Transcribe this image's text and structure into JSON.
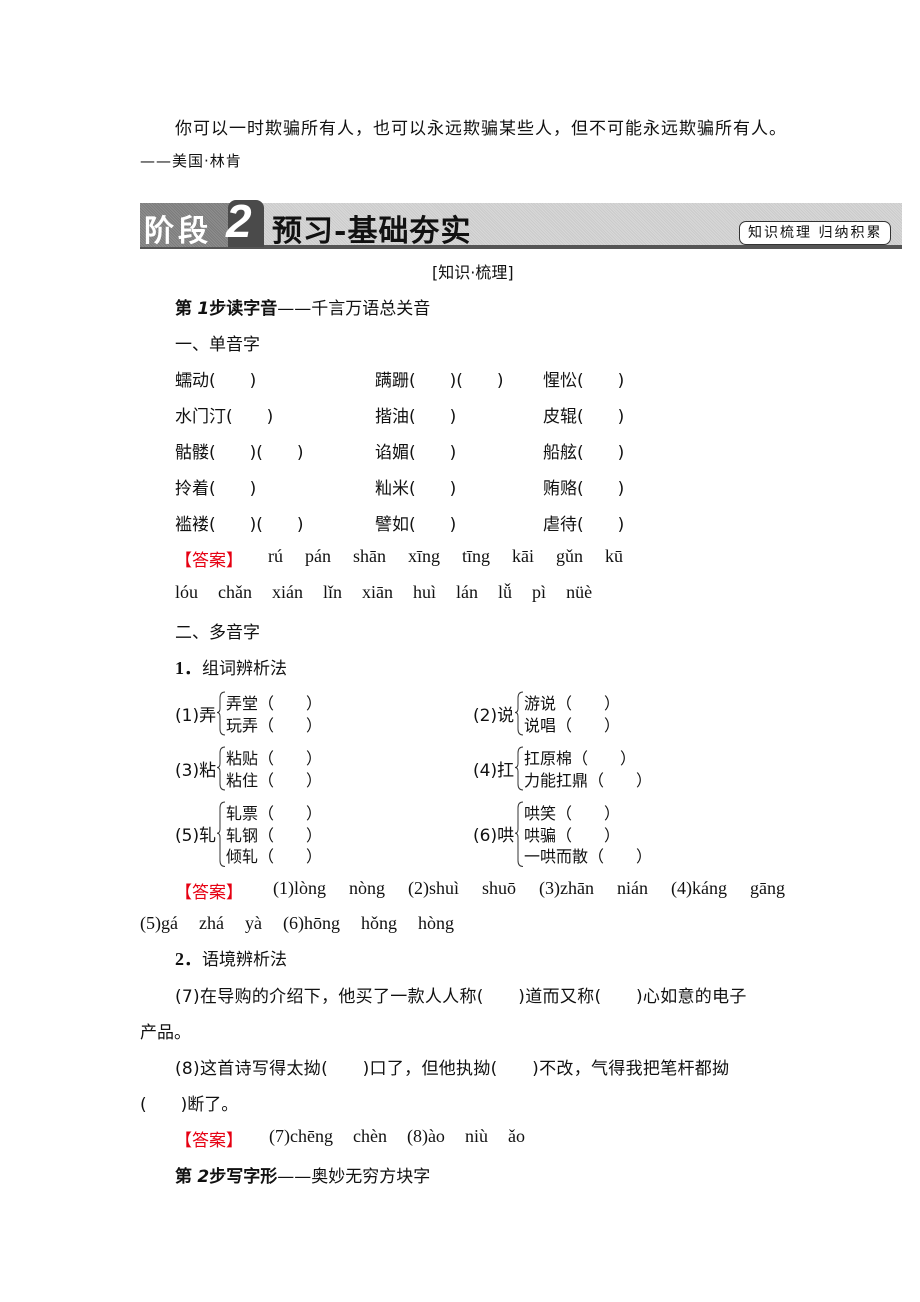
{
  "quote": {
    "text": "你可以一时欺骗所有人，也可以永远欺骗某些人，但不可能永远欺骗所有人。",
    "attribution": "——美国·林肯"
  },
  "banner": {
    "stage_label": "阶段",
    "stage_number": "2",
    "title": "预习-基础夯实",
    "tag": "知识梳理 归纳积累"
  },
  "section_label": "[知识·梳理]",
  "step1": {
    "prefix": "第",
    "number": "1",
    "title": "步读字音",
    "subtitle": "——千言万语总关音"
  },
  "part1": {
    "heading": "一、单音字",
    "rows": [
      [
        "蠕动(　　)",
        "蹒跚(　　)(　　)",
        "惺忪(　　)"
      ],
      [
        "水门汀(　　)",
        "揩油(　　)",
        "皮辊(　　)"
      ],
      [
        "骷髅(　　)(　　)",
        "谄媚(　　)",
        "船舷(　　)"
      ],
      [
        "拎着(　　)",
        "籼米(　　)",
        "贿赂(　　)"
      ],
      [
        "褴褛(　　)(　　)",
        "譬如(　　)",
        "虐待(　　)"
      ]
    ],
    "answer_label": "【答案】",
    "answer_line1": [
      "rú",
      "pán",
      "shān",
      "xīng",
      "tīng",
      "kāi",
      "gǔn",
      "kū"
    ],
    "answer_line2": [
      "lóu",
      "chǎn",
      "xián",
      "lǐn",
      "xiān",
      "huì",
      "lán",
      "lǚ",
      "pì",
      "nüè"
    ]
  },
  "part2": {
    "heading": "二、多音字",
    "method1": {
      "number": "1．",
      "title": "组词辨析法",
      "groups": [
        {
          "label": "(1)弄",
          "items": [
            "弄堂（　　）",
            "玩弄（　　）"
          ]
        },
        {
          "label": "(2)说",
          "items": [
            "游说（　　）",
            "说唱（　　）"
          ]
        },
        {
          "label": "(3)粘",
          "items": [
            "粘贴（　　）",
            "粘住（　　）"
          ]
        },
        {
          "label": "(4)扛",
          "items": [
            "扛原棉（　　）",
            "力能扛鼎（　　）"
          ]
        },
        {
          "label": "(5)轧",
          "items": [
            "轧票（　　）",
            "轧钢（　　）",
            "倾轧（　　）"
          ]
        },
        {
          "label": "(6)哄",
          "items": [
            "哄笑（　　）",
            "哄骗（　　）",
            "一哄而散（　　）"
          ]
        }
      ],
      "answer_label": "【答案】",
      "answer_line1": [
        "(1)lòng",
        "nòng",
        "(2)shuì",
        "shuō",
        "(3)zhān",
        "nián",
        "(4)káng",
        "gāng"
      ],
      "answer_line2": [
        "(5)gá",
        "zhá",
        "yà",
        "(6)hōng",
        "hǒng",
        "hòng"
      ]
    },
    "method2": {
      "number": "2．",
      "title": "语境辨析法",
      "q7_line1": "(7)在导购的介绍下，他买了一款人人称(　　)道而又称(　　)心如意的电子",
      "q7_line2": "产品。",
      "q8_line1": "(8)这首诗写得太拗(　　)口了，但他执拗(　　)不改，气得我把笔杆都拗",
      "q8_line2": "(　　)断了。",
      "answer_label": "【答案】",
      "answers": [
        "(7)chēng",
        "chèn",
        "(8)ào",
        "niù",
        "ǎo"
      ]
    }
  },
  "step2": {
    "prefix": "第",
    "number": "2",
    "title": "步写字形",
    "subtitle": "——奥妙无穷方块字"
  }
}
